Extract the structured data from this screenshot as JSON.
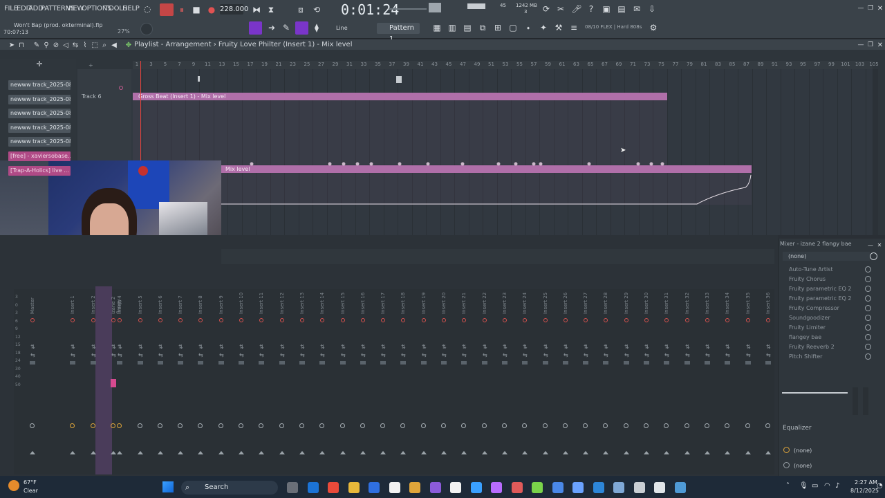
{
  "menu": [
    "FILE",
    "EDIT",
    "ADD",
    "PATTERNS",
    "VIEW",
    "OPTIONS",
    "TOOLS",
    "HELP"
  ],
  "transport": {
    "tempo": "228.000",
    "time": "0:01:24",
    "memory": "1242 MB",
    "cpu_value": "45",
    "cpu_sub": "3",
    "song_title": "Won't Bap (prod. okterminal).flp",
    "song_time": "70:07:13",
    "zoom_pct": "27%"
  },
  "toolbar": {
    "snap": "Line",
    "pattern": "Pattern 1",
    "hint": "08/10  FLEX | Hard 808s"
  },
  "playlist": {
    "title": "Playlist - Arrangement",
    "subtitle": "Fruity Love Philter (Insert 1) - Mix level",
    "ruler_ticks": [
      "1",
      "3",
      "5",
      "7",
      "9",
      "11",
      "13",
      "15",
      "17",
      "19",
      "21",
      "23",
      "25",
      "27",
      "29",
      "31",
      "33",
      "35",
      "37",
      "39",
      "41",
      "43",
      "45",
      "47",
      "49",
      "51",
      "53",
      "55",
      "57",
      "59",
      "61",
      "63",
      "65",
      "67",
      "69",
      "71",
      "73",
      "75",
      "77",
      "79",
      "81",
      "83",
      "85",
      "87",
      "89",
      "91",
      "93",
      "95",
      "97",
      "99",
      "101",
      "103",
      "105"
    ],
    "track6_label": "Track 6",
    "clip1": "Gross Beat (Insert 1) - Mix level",
    "clip2": "Mix level",
    "browser_items": [
      {
        "label": "newww track_2025-08-0...",
        "pink": false
      },
      {
        "label": "newww track_2025-08-0...",
        "pink": false
      },
      {
        "label": "newww track_2025-08-0...",
        "pink": false
      },
      {
        "label": "newww track_2025-08-0...",
        "pink": false
      },
      {
        "label": "newww track_2025-08-0...",
        "pink": false
      },
      {
        "label": "[free] - xaviersobase...",
        "pink": true
      },
      {
        "label": "[Trap-A-Holics] live ...",
        "pink": true
      }
    ]
  },
  "mixer": {
    "title": "Mixer - izane 2 flangy bae",
    "channels": [
      "Master",
      "Insert 1",
      "Insert 2",
      "izane 2 flangy",
      "Insert 4",
      "Insert 5",
      "Insert 6",
      "Insert 7",
      "Insert 8",
      "Insert 9",
      "Insert 10",
      "Insert 11",
      "Insert 12",
      "Insert 13",
      "Insert 14",
      "Insert 15",
      "Insert 16",
      "Insert 17",
      "Insert 18",
      "Insert 19",
      "Insert 20",
      "Insert 21",
      "Insert 22",
      "Insert 23",
      "Insert 24",
      "Insert 25",
      "Insert 26",
      "Insert 27",
      "Insert 28",
      "Insert 29",
      "Insert 30",
      "Insert 31",
      "Insert 32",
      "Insert 33",
      "Insert 34",
      "Insert 35",
      "Insert 36"
    ],
    "db_scale": [
      "3",
      "0",
      "3",
      "6",
      "9",
      "12",
      "15",
      "18",
      "24",
      "30",
      "40",
      "50"
    ],
    "input": "(none)",
    "fx_slots": [
      "Auto-Tune Artist",
      "Fruity Chorus",
      "Fruity parametric EQ 2",
      "Fruity parametric EQ 2",
      "Fruity Compressor",
      "Soundgoodizer",
      "Fruity Limiter",
      "flangey bae",
      "Fruity Reeverb 2",
      "Pitch Shifter"
    ],
    "eq_label": "Equalizer",
    "out1": "(none)",
    "out2": "(none)"
  },
  "taskbar": {
    "weather_temp": "67°F",
    "weather_desc": "Clear",
    "search": "Search",
    "clock_time": "2:27 AM",
    "clock_date": "8/12/2025"
  },
  "colors": {
    "clip": "#b06fa9",
    "playhead": "#e2443e",
    "accent_pink": "#b04a86",
    "toolbar_highlight": "#7a35c9"
  }
}
